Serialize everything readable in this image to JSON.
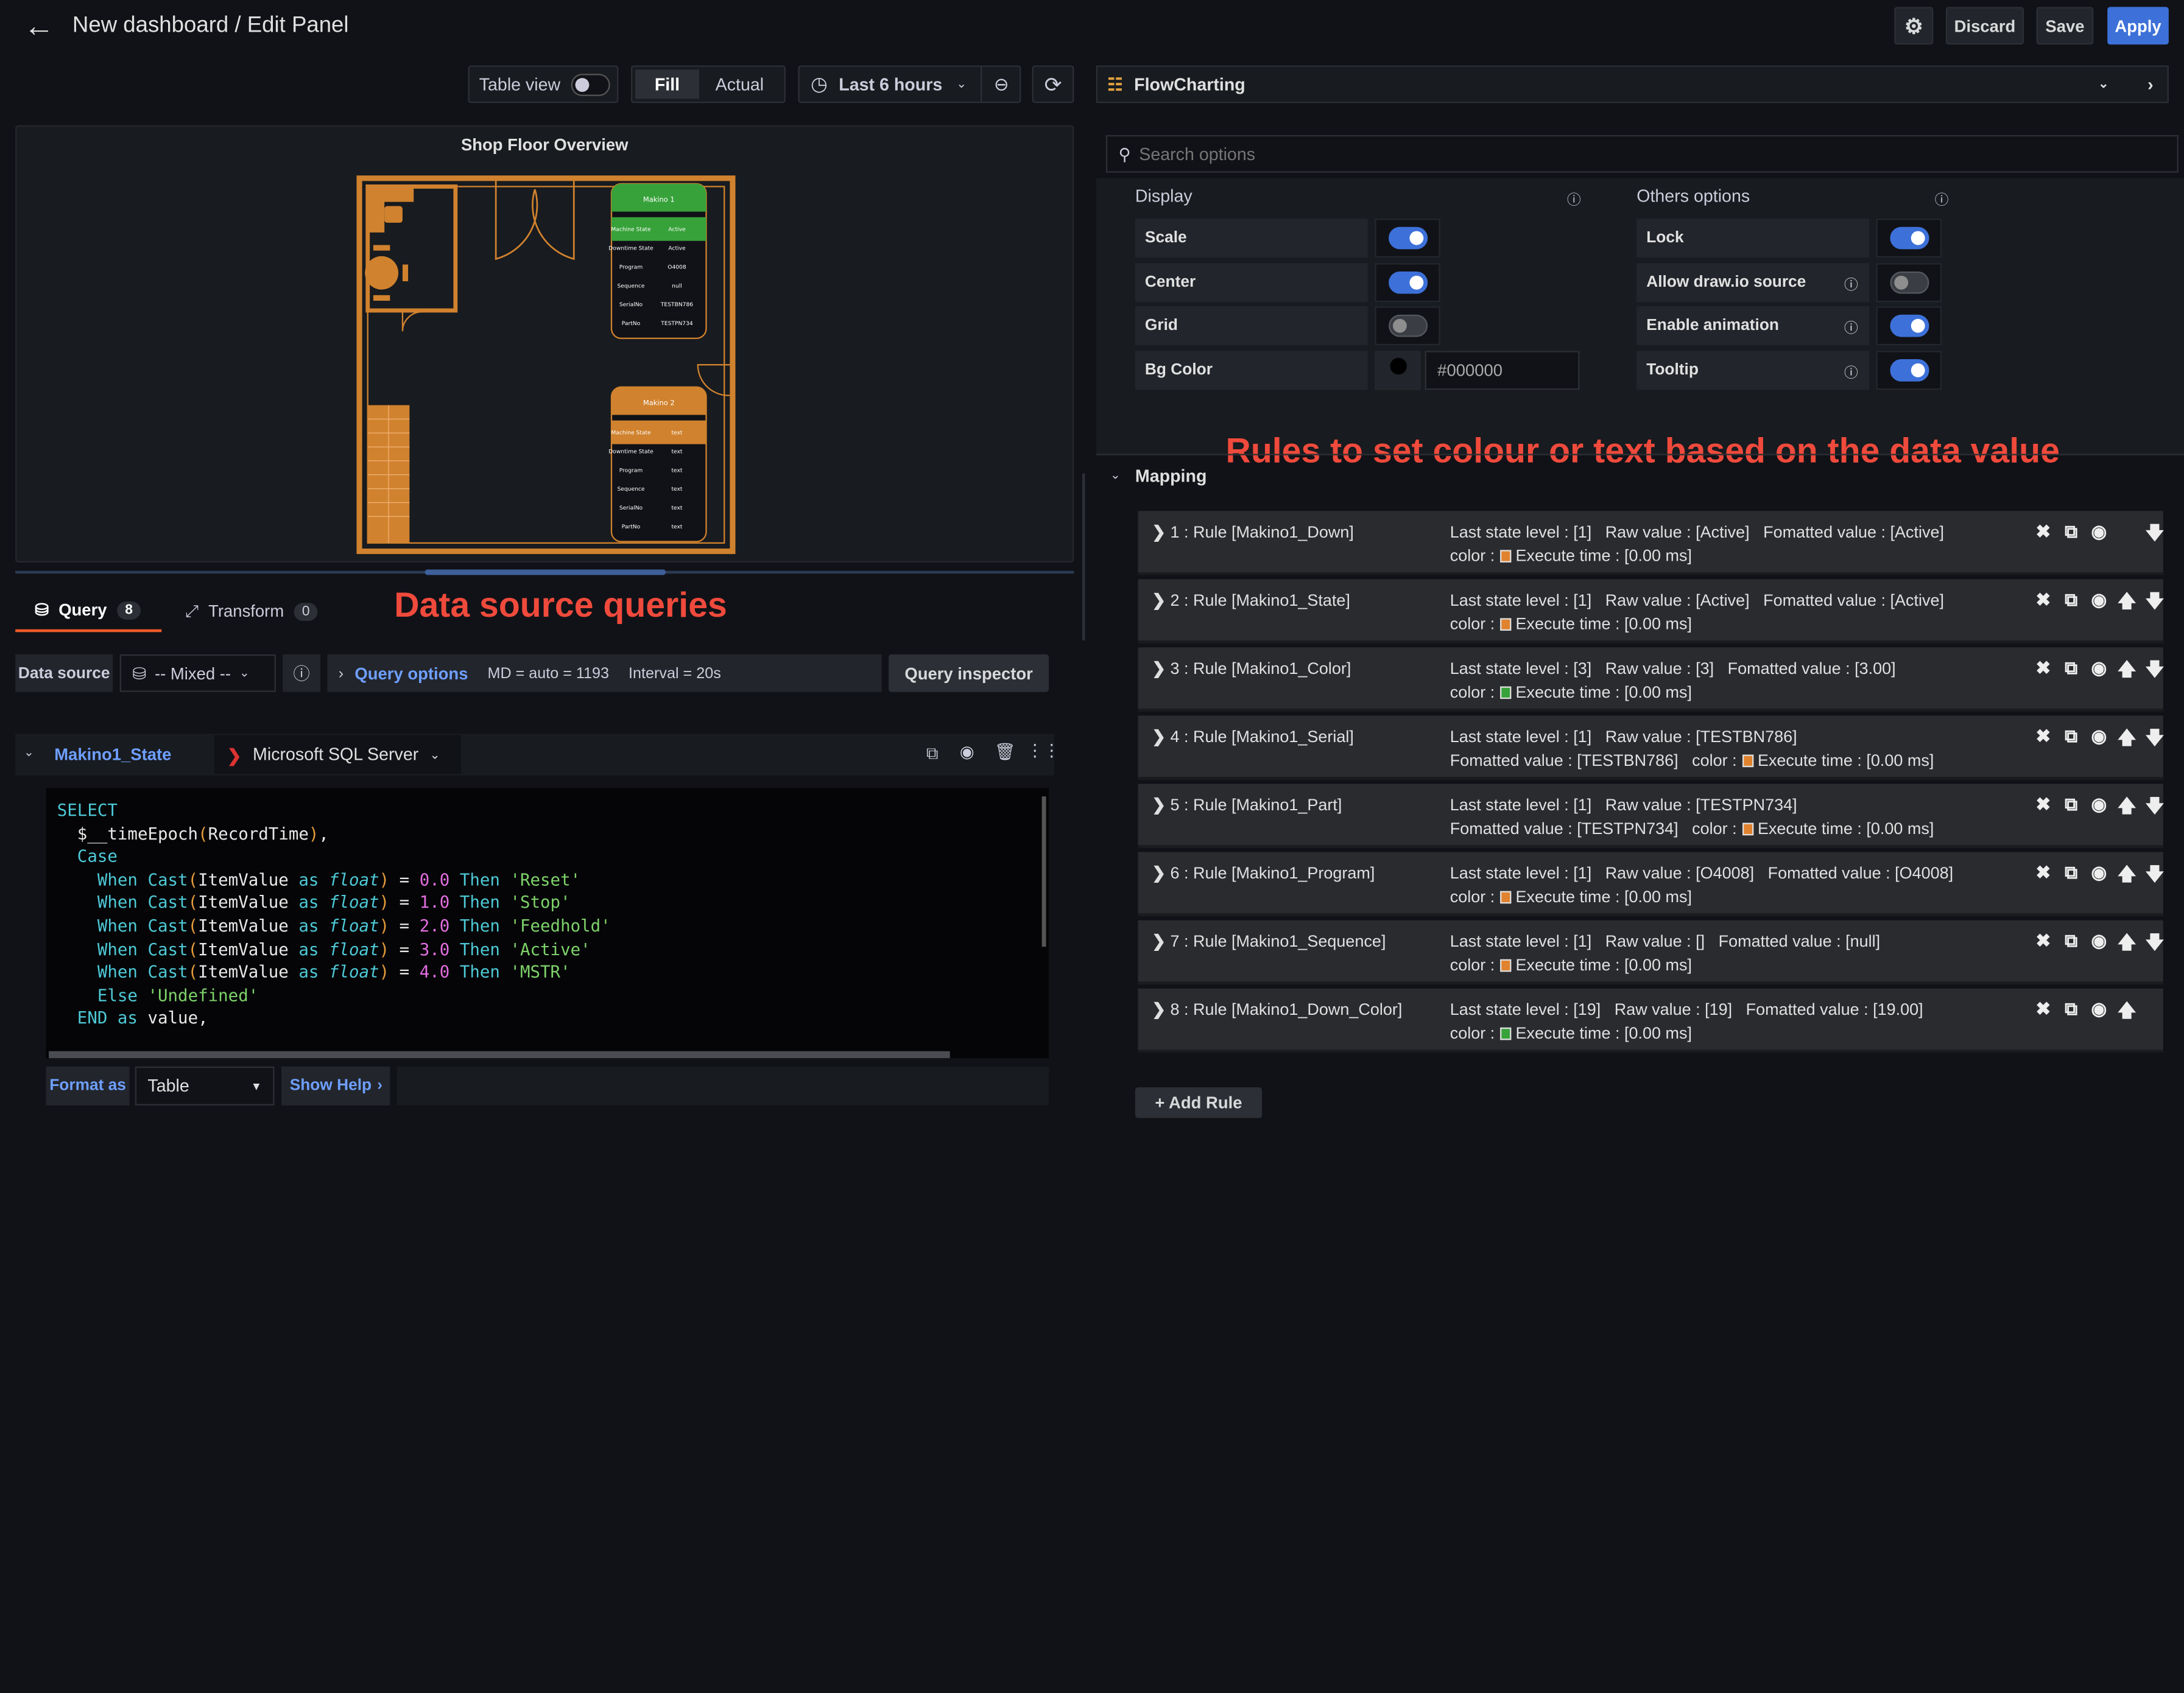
{
  "header": {
    "title": "New dashboard / Edit Panel",
    "discard": "Discard",
    "save": "Save",
    "apply": "Apply"
  },
  "toolbar": {
    "table_view": "Table view",
    "fill": "Fill",
    "actual": "Actual",
    "time_range": "Last 6 hours"
  },
  "panel": {
    "title": "Shop Floor Overview",
    "machines": [
      {
        "name": "Makino 1",
        "color": "#37a23a",
        "rows": [
          [
            "Machine State",
            "Active"
          ],
          [
            "Downtime State",
            "Active"
          ],
          [
            "Program",
            "O4008"
          ],
          [
            "Sequence",
            "null"
          ],
          [
            "SerialNo",
            "TESTBN786"
          ],
          [
            "PartNo",
            "TESTPN734"
          ]
        ]
      },
      {
        "name": "Makino 2",
        "color": "#d0822e",
        "rows": [
          [
            "Machine State",
            "text"
          ],
          [
            "Downtime State",
            "text"
          ],
          [
            "Program",
            "text"
          ],
          [
            "Sequence",
            "text"
          ],
          [
            "SerialNo",
            "text"
          ],
          [
            "PartNo",
            "text"
          ]
        ]
      }
    ]
  },
  "tabs": [
    {
      "label": "Query",
      "count": "8"
    },
    {
      "label": "Transform",
      "count": "0"
    }
  ],
  "annotations": {
    "queries": "Data source queries",
    "rules": "Rules to set colour or text based on the data value"
  },
  "datasource": {
    "label": "Data source",
    "value": "-- Mixed --",
    "query_options": "Query options",
    "md": "MD = auto = 1193",
    "interval": "Interval = 20s",
    "inspector": "Query inspector"
  },
  "query": {
    "name": "Makino1_State",
    "datasource": "Microsoft SQL Server",
    "code": [
      [
        [
          "k",
          "SELECT"
        ]
      ],
      [
        [
          "w",
          "  $__timeEpoch"
        ],
        [
          "p",
          "("
        ],
        [
          "w",
          "RecordTime"
        ],
        [
          "p",
          ")"
        ],
        [
          "w",
          ","
        ]
      ],
      [
        [
          "k",
          "  Case"
        ]
      ],
      [
        [
          "k",
          "    When Cast"
        ],
        [
          "p",
          "("
        ],
        [
          "w",
          "ItemValue "
        ],
        [
          "k",
          "as "
        ],
        [
          "f",
          "float"
        ],
        [
          "p",
          ")"
        ],
        [
          "w",
          " = "
        ],
        [
          "n",
          "0.0"
        ],
        [
          "k",
          " Then "
        ],
        [
          "s",
          "'Reset'"
        ]
      ],
      [
        [
          "k",
          "    When Cast"
        ],
        [
          "p",
          "("
        ],
        [
          "w",
          "ItemValue "
        ],
        [
          "k",
          "as "
        ],
        [
          "f",
          "float"
        ],
        [
          "p",
          ")"
        ],
        [
          "w",
          " = "
        ],
        [
          "n",
          "1.0"
        ],
        [
          "k",
          " Then "
        ],
        [
          "s",
          "'Stop'"
        ]
      ],
      [
        [
          "k",
          "    When Cast"
        ],
        [
          "p",
          "("
        ],
        [
          "w",
          "ItemValue "
        ],
        [
          "k",
          "as "
        ],
        [
          "f",
          "float"
        ],
        [
          "p",
          ")"
        ],
        [
          "w",
          " = "
        ],
        [
          "n",
          "2.0"
        ],
        [
          "k",
          " Then "
        ],
        [
          "s",
          "'Feedhold'"
        ]
      ],
      [
        [
          "k",
          "    When Cast"
        ],
        [
          "p",
          "("
        ],
        [
          "w",
          "ItemValue "
        ],
        [
          "k",
          "as "
        ],
        [
          "f",
          "float"
        ],
        [
          "p",
          ")"
        ],
        [
          "w",
          " = "
        ],
        [
          "n",
          "3.0"
        ],
        [
          "k",
          " Then "
        ],
        [
          "s",
          "'Active'"
        ]
      ],
      [
        [
          "k",
          "    When Cast"
        ],
        [
          "p",
          "("
        ],
        [
          "w",
          "ItemValue "
        ],
        [
          "k",
          "as "
        ],
        [
          "f",
          "float"
        ],
        [
          "p",
          ")"
        ],
        [
          "w",
          " = "
        ],
        [
          "n",
          "4.0"
        ],
        [
          "k",
          " Then "
        ],
        [
          "s",
          "'MSTR'"
        ]
      ],
      [
        [
          "k",
          "    Else "
        ],
        [
          "s",
          "'Undefined'"
        ]
      ],
      [
        [
          "k",
          "  END as "
        ],
        [
          "w",
          "value,"
        ]
      ]
    ],
    "format_label": "Format as",
    "format_value": "Table",
    "show_help": "Show Help"
  },
  "options": {
    "visualization": "FlowCharting",
    "search_placeholder": "Search options",
    "display_title": "Display",
    "others_title": "Others options",
    "display": [
      {
        "label": "Scale",
        "on": true
      },
      {
        "label": "Center",
        "on": true
      },
      {
        "label": "Grid",
        "on": false
      }
    ],
    "bg_label": "Bg Color",
    "bg_value": "#000000",
    "others": [
      {
        "label": "Lock",
        "on": true,
        "info": false
      },
      {
        "label": "Allow draw.io source",
        "on": false,
        "info": true
      },
      {
        "label": "Enable animation",
        "on": true,
        "info": true
      },
      {
        "label": "Tooltip",
        "on": true,
        "info": true
      }
    ],
    "mapping_title": "Mapping",
    "add_rule": "+ Add Rule"
  },
  "rules": [
    {
      "title": "1 : Rule [Makino1_Down]",
      "l1": "Last state level : [1]   Raw value : [Active]   Fomatted value : [Active]",
      "l2": "color :",
      "color": "#e0822e",
      "exec": "Execute time : [0.00 ms]",
      "up": false,
      "down": true
    },
    {
      "title": "2 : Rule [Makino1_State]",
      "l1": "Last state level : [1]   Raw value : [Active]   Fomatted value : [Active]",
      "l2": "color :",
      "color": "#e0822e",
      "exec": "Execute time : [0.00 ms]",
      "up": true,
      "down": true
    },
    {
      "title": "3 : Rule [Makino1_Color]",
      "l1": "Last state level : [3]   Raw value : [3]   Fomatted value : [3.00]",
      "l2": "color :",
      "color": "#37a23a",
      "exec": "Execute time : [0.00 ms]",
      "up": true,
      "down": true
    },
    {
      "title": "4 : Rule [Makino1_Serial]",
      "l1": "Last state level : [1]   Raw value : [TESTBN786]",
      "l2": "Fomatted value : [TESTBN786]   color :",
      "color": "#e0822e",
      "exec": "Execute time : [0.00 ms]",
      "up": true,
      "down": true
    },
    {
      "title": "5 : Rule [Makino1_Part]",
      "l1": "Last state level : [1]   Raw value : [TESTPN734]",
      "l2": "Fomatted value : [TESTPN734]   color :",
      "color": "#e0822e",
      "exec": "Execute time : [0.00 ms]",
      "up": true,
      "down": true
    },
    {
      "title": "6 : Rule [Makino1_Program]",
      "l1": "Last state level : [1]   Raw value : [O4008]   Fomatted value : [O4008]",
      "l2": "color :",
      "color": "#e0822e",
      "exec": "Execute time : [0.00 ms]",
      "up": true,
      "down": true
    },
    {
      "title": "7 : Rule [Makino1_Sequence]",
      "l1": "Last state level : [1]   Raw value : []   Fomatted value : [null]",
      "l2": "color :",
      "color": "#e0822e",
      "exec": "Execute time : [0.00 ms]",
      "up": true,
      "down": true
    },
    {
      "title": "8 : Rule [Makino1_Down_Color]",
      "l1": "Last state level : [19]   Raw value : [19]   Fomatted value : [19.00]",
      "l2": "color :",
      "color": "#37a23a",
      "exec": "Execute time : [0.00 ms]",
      "up": true,
      "down": false
    }
  ],
  "colors": {
    "accent": "#3d71d9",
    "wall": "#d0822e",
    "link": "#6e9fff",
    "annotation": "#ef4a3c"
  }
}
